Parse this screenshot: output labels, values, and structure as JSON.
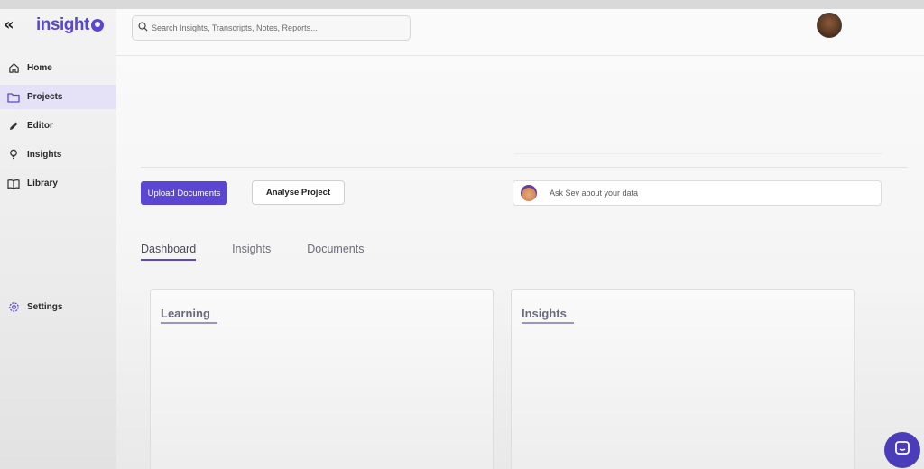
{
  "app": {
    "logo_text": "insight"
  },
  "sidebar": {
    "collapse_label": "«",
    "items": [
      {
        "label": "Home",
        "icon": "home-icon",
        "active": false
      },
      {
        "label": "Projects",
        "icon": "folder-icon",
        "active": true
      },
      {
        "label": "Editor",
        "icon": "pencil-icon",
        "active": false
      },
      {
        "label": "Insights",
        "icon": "lightbulb-icon",
        "active": false
      },
      {
        "label": "Library",
        "icon": "book-icon",
        "active": false
      }
    ],
    "settings": {
      "label": "Settings",
      "icon": "gear-icon"
    }
  },
  "topbar": {
    "search_placeholder": "Search Insights, Transcripts, Notes, Reports..."
  },
  "actions": {
    "upload_label": "Upload Documents",
    "analyse_label": "Analyse Project",
    "ask_placeholder": "Ask Sev about your data"
  },
  "tabs": [
    {
      "label": "Dashboard",
      "active": true
    },
    {
      "label": "Insights",
      "active": false
    },
    {
      "label": "Documents",
      "active": false
    }
  ],
  "cards": {
    "learning_title": "Learning",
    "insights_title": "Insights"
  },
  "colors": {
    "accent": "#5b46d1",
    "active_nav_bg": "#e5e1f7"
  }
}
